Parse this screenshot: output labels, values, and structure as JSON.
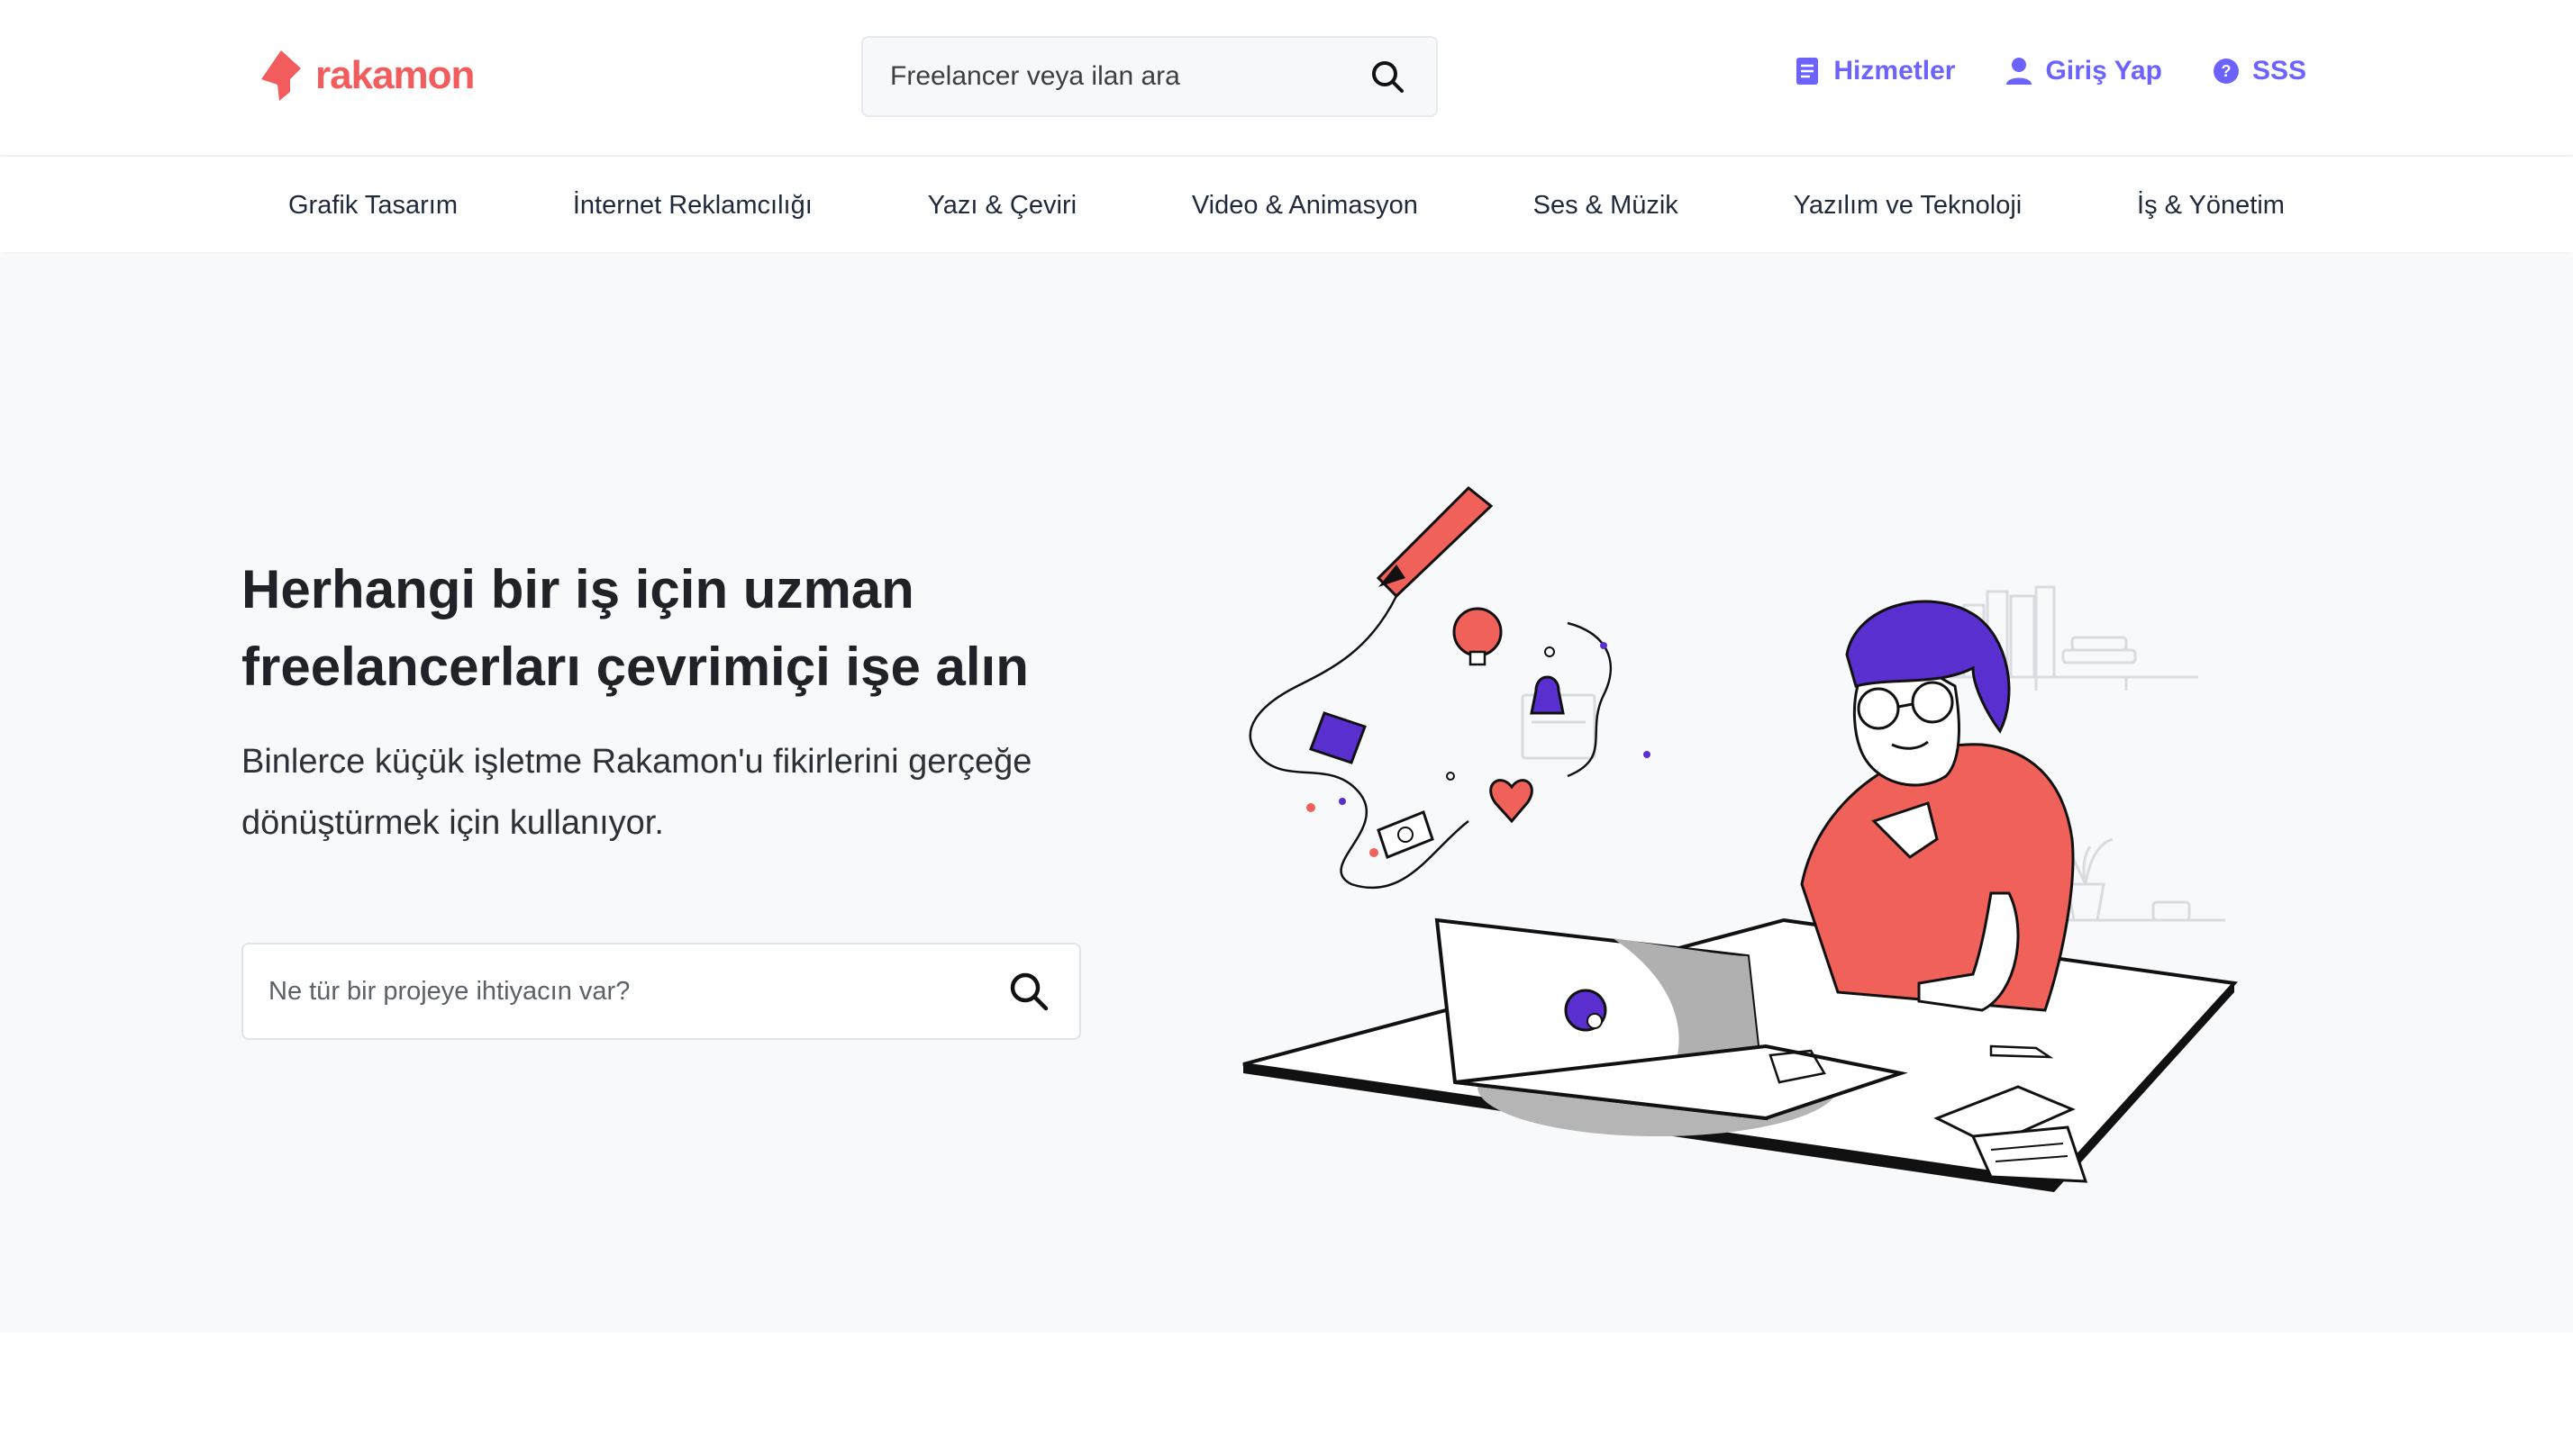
{
  "brand": {
    "name": "rakamon",
    "color": "#f25c5c"
  },
  "header": {
    "search_placeholder": "Freelancer veya ilan ara",
    "links": [
      {
        "label": "Hizmetler",
        "icon": "document-icon"
      },
      {
        "label": "Giriş Yap",
        "icon": "user-icon"
      },
      {
        "label": "SSS",
        "icon": "question-circle-icon"
      }
    ],
    "accent": "#6c63ff"
  },
  "categories": [
    "Grafik Tasarım",
    "İnternet Reklamcılığı",
    "Yazı & Çeviri",
    "Video & Animasyon",
    "Ses & Müzik",
    "Yazılım ve Teknoloji",
    "İş & Yönetim"
  ],
  "hero": {
    "title_line1": "Herhangi bir iş için uzman",
    "title_line2": "freelancerları çevrimiçi işe alın",
    "subtitle_line1": "Binlerce küçük işletme Rakamon'u fikirlerini gerçeğe",
    "subtitle_line2": "dönüştürmek için kullanıyor.",
    "search_placeholder": "Ne tür bir projeye ihtiyacın var?"
  }
}
